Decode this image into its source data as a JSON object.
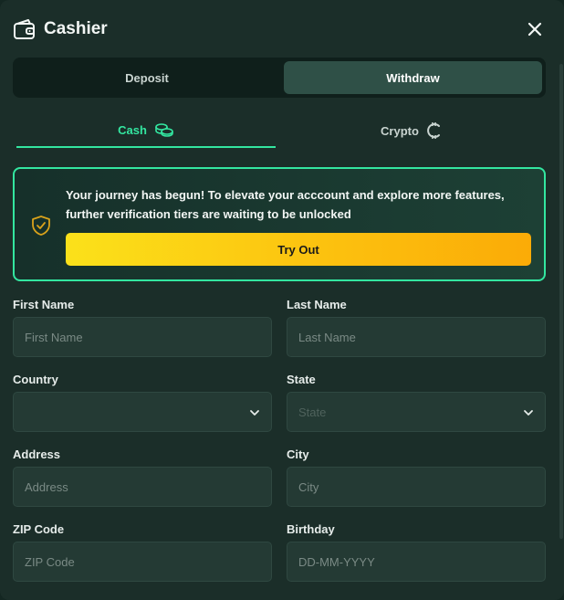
{
  "header": {
    "title": "Cashier"
  },
  "mode_toggle": {
    "deposit": "Deposit",
    "withdraw": "Withdraw",
    "active": "withdraw"
  },
  "tabs": {
    "cash": "Cash",
    "crypto": "Crypto",
    "active": "cash"
  },
  "banner": {
    "message": "Your journey has begun! To elevate your acccount and explore more features, further verification tiers are waiting to be unlocked",
    "button": "Try Out"
  },
  "form": {
    "first_name": {
      "label": "First Name",
      "placeholder": "First Name",
      "value": ""
    },
    "last_name": {
      "label": "Last Name",
      "placeholder": "Last Name",
      "value": ""
    },
    "country": {
      "label": "Country",
      "selected": ""
    },
    "state": {
      "label": "State",
      "selected": "State"
    },
    "address": {
      "label": "Address",
      "placeholder": "Address",
      "value": ""
    },
    "city": {
      "label": "City",
      "placeholder": "City",
      "value": ""
    },
    "zip": {
      "label": "ZIP Code",
      "placeholder": "ZIP Code",
      "value": ""
    },
    "birthday": {
      "label": "Birthday",
      "placeholder": "DD-MM-YYYY",
      "value": ""
    }
  },
  "colors": {
    "accent": "#33e6a0",
    "panel": "#1b2e29",
    "button_gradient_start": "#fbe11a",
    "button_gradient_end": "#fbab07"
  },
  "icons": {
    "header": "wallet-icon",
    "close": "close-icon",
    "cash_tab": "coins-icon",
    "crypto_tab": "crypto-coin-icon",
    "banner": "shield-check-icon",
    "select": "chevron-down-icon"
  }
}
